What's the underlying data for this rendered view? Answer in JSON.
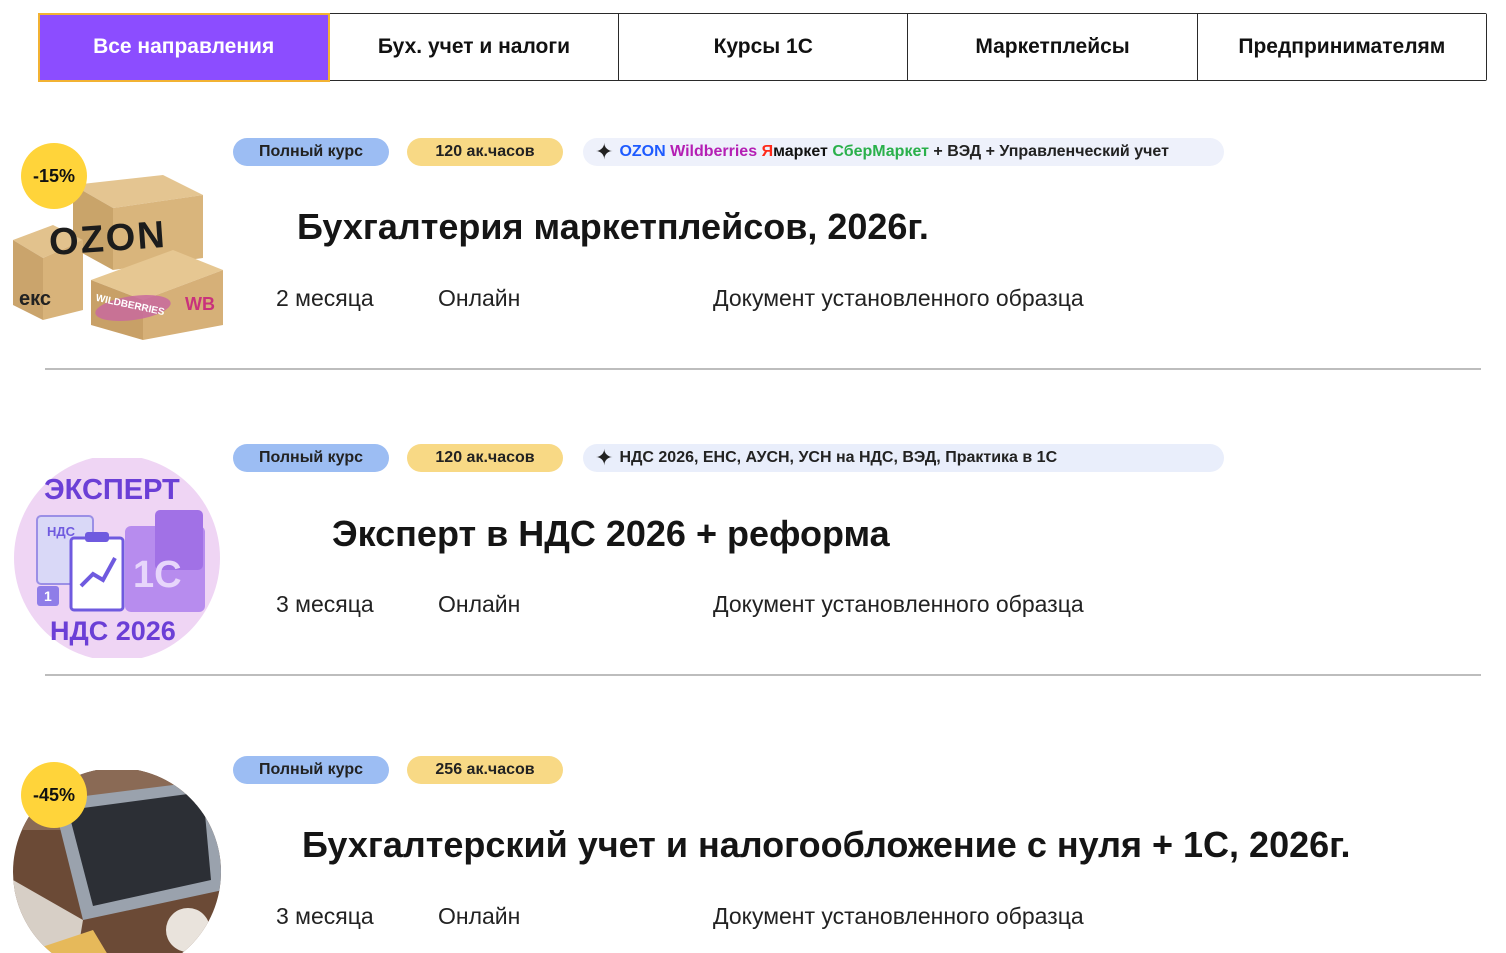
{
  "tabs": [
    {
      "label": "Все направления",
      "active": true
    },
    {
      "label": "Бух. учет и налоги",
      "active": false
    },
    {
      "label": "Курсы 1С",
      "active": false
    },
    {
      "label": "Маркетплейсы",
      "active": false
    },
    {
      "label": "Предпринимателям",
      "active": false
    }
  ],
  "courses": [
    {
      "discount": "-15%",
      "badge_type": "Полный курс",
      "badge_hours": "120 ак.часов",
      "tags": {
        "ozon": "OZON",
        "wb": "Wildberries",
        "ya_letter": "Я",
        "ya_rest": "маркет",
        "sber": "СберМаркет",
        "rest": "+ ВЭД + Управленческий учет"
      },
      "image_labels": {
        "ozon": "OZON",
        "yandex": "екс",
        "wb": "WILDBERRIES",
        "wb_short": "WB"
      },
      "title": "Бухгалтерия маркетплейсов, 2026г.",
      "duration": "2 месяца",
      "format": "Онлайн",
      "certificate": "Документ установленного образца"
    },
    {
      "discount": "",
      "badge_type": "Полный курс",
      "badge_hours": "120 ак.часов",
      "tags_text": "НДС 2026, ЕНС, АУСН, УСН на НДС, ВЭД, Практика в 1С",
      "image_labels": {
        "top": "ЭКСПЕРТ",
        "doc": "НДС",
        "bottom": "НДС 2026",
        "num": "1"
      },
      "title": "Эксперт в НДС 2026 + реформа",
      "duration": "3 месяца",
      "format": "Онлайн",
      "certificate": "Документ установленного образца"
    },
    {
      "discount": "-45%",
      "badge_type": "Полный курс",
      "badge_hours": "256 ак.часов",
      "title": "Бухгалтерский учет и налогообложение с нуля + 1С, 2026г.",
      "duration": "3 месяца",
      "format": "Онлайн",
      "certificate": "Документ установленного образца"
    }
  ],
  "colors": {
    "active_tab": "#8c4dff",
    "active_tab_border": "#f2b233",
    "pill_full": "#9cbdf3",
    "pill_hours": "#f8d985",
    "discount_badge": "#ffd43a"
  }
}
